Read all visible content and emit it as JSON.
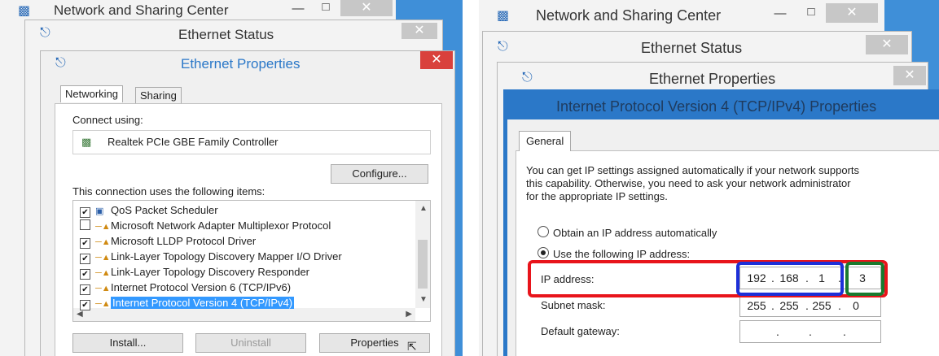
{
  "left": {
    "win_back": {
      "title": "Network and Sharing Center"
    },
    "win_mid": {
      "title": "Ethernet Status"
    },
    "win_front": {
      "title": "Ethernet Properties",
      "tabs": [
        "Networking",
        "Sharing"
      ],
      "connect_using_label": "Connect using:",
      "adapter_name": "Realtek PCIe GBE Family Controller",
      "configure_label": "Configure...",
      "items_label": "This connection uses the following items:",
      "items": [
        {
          "label": "QoS Packet Scheduler",
          "checked": true,
          "selected": false
        },
        {
          "label": "Microsoft Network Adapter Multiplexor Protocol",
          "checked": false,
          "selected": false
        },
        {
          "label": "Microsoft LLDP Protocol Driver",
          "checked": true,
          "selected": false
        },
        {
          "label": "Link-Layer Topology Discovery Mapper I/O Driver",
          "checked": true,
          "selected": false
        },
        {
          "label": "Link-Layer Topology Discovery Responder",
          "checked": true,
          "selected": false
        },
        {
          "label": "Internet Protocol Version 6 (TCP/IPv6)",
          "checked": true,
          "selected": false
        },
        {
          "label": "Internet Protocol Version 4 (TCP/IPv4)",
          "checked": true,
          "selected": true
        }
      ],
      "buttons": {
        "install": "Install...",
        "uninstall": "Uninstall",
        "properties": "Properties"
      }
    }
  },
  "right": {
    "win_back": {
      "title": "Network and Sharing Center"
    },
    "win_mid": {
      "title": "Ethernet Status"
    },
    "win_mid2": {
      "title": "Ethernet Properties"
    },
    "win_front": {
      "title": "Internet Protocol Version 4 (TCP/IPv4) Properties",
      "tab": "General",
      "description_lines": [
        "You can get IP settings assigned automatically if your network supports",
        "this capability. Otherwise, you need to ask your network administrator",
        "for the appropriate IP settings."
      ],
      "radio_auto": "Obtain an IP address automatically",
      "radio_manual": "Use the following IP address:",
      "ip_label": "IP address:",
      "ip_value": [
        "192",
        "168",
        "1",
        "3"
      ],
      "subnet_label": "Subnet mask:",
      "subnet_value": [
        "255",
        "255",
        "255",
        "0"
      ],
      "gateway_label": "Default gateway:",
      "gateway_value": [
        "",
        "",
        "",
        ""
      ]
    },
    "highlight_colors": {
      "outer": "#e8141b",
      "network_part": "#1d2fd8",
      "host_part": "#1a7a2e"
    }
  },
  "colors": {
    "close_active": "#d9413c",
    "selection": "#3399ff",
    "title_front": "#2b78c8"
  }
}
